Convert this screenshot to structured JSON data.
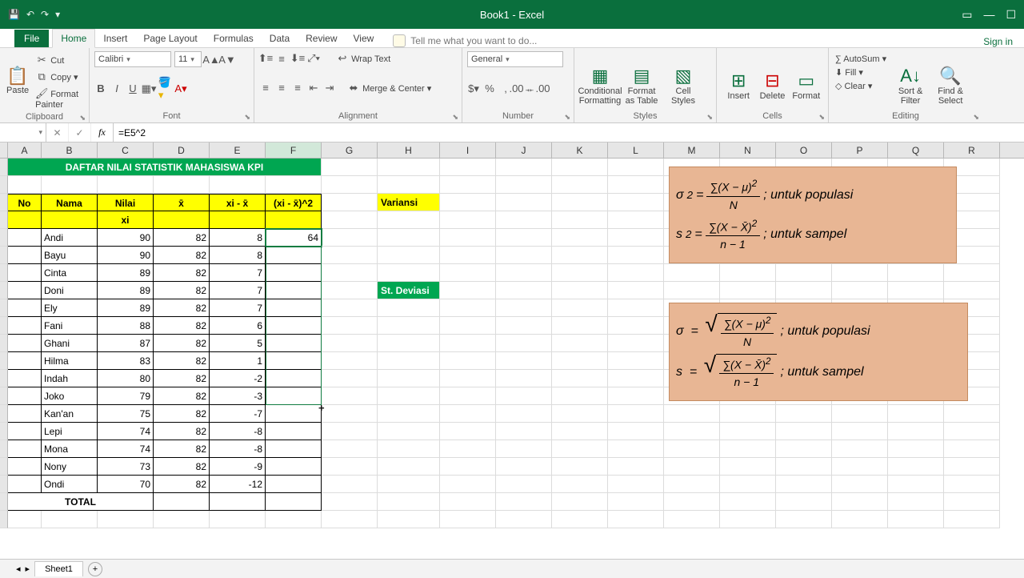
{
  "titlebar": {
    "title": "Book1 - Excel"
  },
  "ribbon": {
    "file": "File",
    "tabs": [
      "Home",
      "Insert",
      "Page Layout",
      "Formulas",
      "Data",
      "Review",
      "View"
    ],
    "tell": "Tell me what you want to do...",
    "signin": "Sign in",
    "clipboard": {
      "cut": "Cut",
      "copy": "Copy",
      "fp": "Format Painter",
      "label": "Clipboard"
    },
    "font": {
      "name": "Calibri",
      "size": "11",
      "label": "Font"
    },
    "alignment": {
      "wrap": "Wrap Text",
      "merge": "Merge & Center",
      "label": "Alignment"
    },
    "number": {
      "format": "General",
      "label": "Number"
    },
    "styles": {
      "cond": "Conditional Formatting",
      "fat": "Format as Table",
      "cell": "Cell Styles",
      "label": "Styles"
    },
    "cells": {
      "ins": "Insert",
      "del": "Delete",
      "fmt": "Format",
      "label": "Cells"
    },
    "editing": {
      "sum": "AutoSum",
      "fill": "Fill",
      "clear": "Clear",
      "sort": "Sort & Filter",
      "find": "Find & Select",
      "label": "Editing"
    }
  },
  "fxbar": {
    "name": "",
    "formula": "=E5^2"
  },
  "cols": [
    "A",
    "B",
    "C",
    "D",
    "E",
    "F",
    "G",
    "H",
    "I",
    "J",
    "K",
    "L",
    "M",
    "N",
    "O",
    "P",
    "Q",
    "R"
  ],
  "table": {
    "title": "DAFTAR NILAI STATISTIK MAHASISWA KPI",
    "h": {
      "no": "No",
      "nama": "Nama",
      "nilai": "Nilai",
      "xbar": "x̄",
      "diff": "xi - x̄",
      "sq": "(xi - x̄)^2",
      "xi": "xi"
    },
    "rows": [
      {
        "nama": "Andi",
        "nilai": "90",
        "xbar": "82",
        "diff": "8",
        "sq": "64"
      },
      {
        "nama": "Bayu",
        "nilai": "90",
        "xbar": "82",
        "diff": "8",
        "sq": ""
      },
      {
        "nama": "Cinta",
        "nilai": "89",
        "xbar": "82",
        "diff": "7",
        "sq": ""
      },
      {
        "nama": "Doni",
        "nilai": "89",
        "xbar": "82",
        "diff": "7",
        "sq": ""
      },
      {
        "nama": "Ely",
        "nilai": "89",
        "xbar": "82",
        "diff": "7",
        "sq": ""
      },
      {
        "nama": "Fani",
        "nilai": "88",
        "xbar": "82",
        "diff": "6",
        "sq": ""
      },
      {
        "nama": "Ghani",
        "nilai": "87",
        "xbar": "82",
        "diff": "5",
        "sq": ""
      },
      {
        "nama": "Hilma",
        "nilai": "83",
        "xbar": "82",
        "diff": "1",
        "sq": ""
      },
      {
        "nama": "Indah",
        "nilai": "80",
        "xbar": "82",
        "diff": "-2",
        "sq": ""
      },
      {
        "nama": "Joko",
        "nilai": "79",
        "xbar": "82",
        "diff": "-3",
        "sq": ""
      },
      {
        "nama": "Kan'an",
        "nilai": "75",
        "xbar": "82",
        "diff": "-7",
        "sq": ""
      },
      {
        "nama": "Lepi",
        "nilai": "74",
        "xbar": "82",
        "diff": "-8",
        "sq": ""
      },
      {
        "nama": "Mona",
        "nilai": "74",
        "xbar": "82",
        "diff": "-8",
        "sq": ""
      },
      {
        "nama": "Nony",
        "nilai": "73",
        "xbar": "82",
        "diff": "-9",
        "sq": ""
      },
      {
        "nama": "Ondi",
        "nilai": "70",
        "xbar": "82",
        "diff": "-12",
        "sq": ""
      }
    ],
    "total": "TOTAL"
  },
  "labels": {
    "variansi": "Variansi",
    "stdev": "St. Deviasi"
  },
  "formulas": {
    "var_pop": "; untuk populasi",
    "var_samp": "; untuk sampel",
    "sd_pop": "; untuk populasi",
    "sd_samp": "; untuk sampel"
  },
  "sheet": {
    "name": "Sheet1"
  },
  "chart_data": {
    "type": "table",
    "title": "DAFTAR NILAI STATISTIK MAHASISWA KPI",
    "columns": [
      "Nama",
      "Nilai (xi)",
      "x̄",
      "xi - x̄",
      "(xi - x̄)^2"
    ],
    "rows": [
      [
        "Andi",
        90,
        82,
        8,
        64
      ],
      [
        "Bayu",
        90,
        82,
        8,
        null
      ],
      [
        "Cinta",
        89,
        82,
        7,
        null
      ],
      [
        "Doni",
        89,
        82,
        7,
        null
      ],
      [
        "Ely",
        89,
        82,
        7,
        null
      ],
      [
        "Fani",
        88,
        82,
        6,
        null
      ],
      [
        "Ghani",
        87,
        82,
        5,
        null
      ],
      [
        "Hilma",
        83,
        82,
        1,
        null
      ],
      [
        "Indah",
        80,
        82,
        -2,
        null
      ],
      [
        "Joko",
        79,
        82,
        -3,
        null
      ],
      [
        "Kan'an",
        75,
        82,
        -7,
        null
      ],
      [
        "Lepi",
        74,
        82,
        -8,
        null
      ],
      [
        "Mona",
        74,
        82,
        -8,
        null
      ],
      [
        "Nony",
        73,
        82,
        -9,
        null
      ],
      [
        "Ondi",
        70,
        82,
        -12,
        null
      ]
    ]
  }
}
